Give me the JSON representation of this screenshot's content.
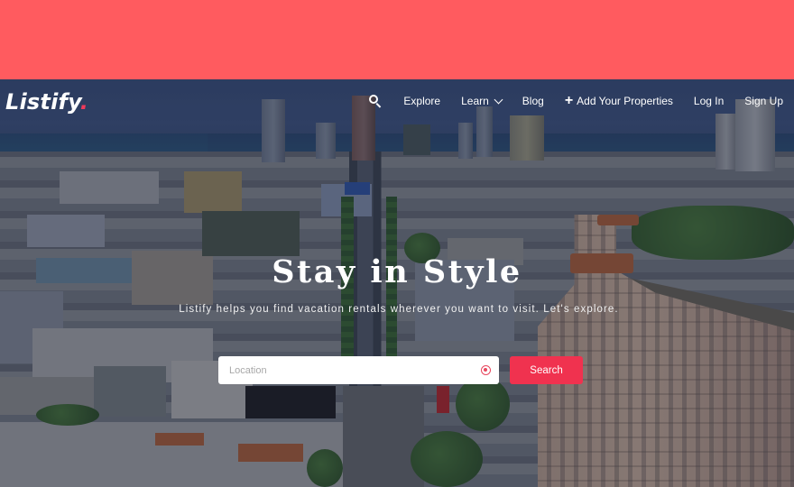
{
  "page": {
    "top_band_color": "#FF5B5F",
    "accent_color": "#F0324F"
  },
  "header": {
    "logo_text": "Listify",
    "logo_dot": ".",
    "nav": {
      "search_icon": "search-icon",
      "items": [
        {
          "label": "Explore"
        },
        {
          "label": "Learn",
          "icon": "chevron-down-icon"
        },
        {
          "label": "Blog"
        },
        {
          "label": "Add Your Properties",
          "icon": "plus-icon"
        },
        {
          "label": "Log In"
        },
        {
          "label": "Sign Up"
        }
      ]
    }
  },
  "hero": {
    "title": "Stay in Style",
    "subtitle": "Listify helps you find vacation rentals wherever you want to visit. Let's explore.",
    "background": "aerial city photo"
  },
  "search": {
    "location_placeholder": "Location",
    "location_value": "",
    "locate_icon": "target-icon",
    "button_label": "Search"
  }
}
